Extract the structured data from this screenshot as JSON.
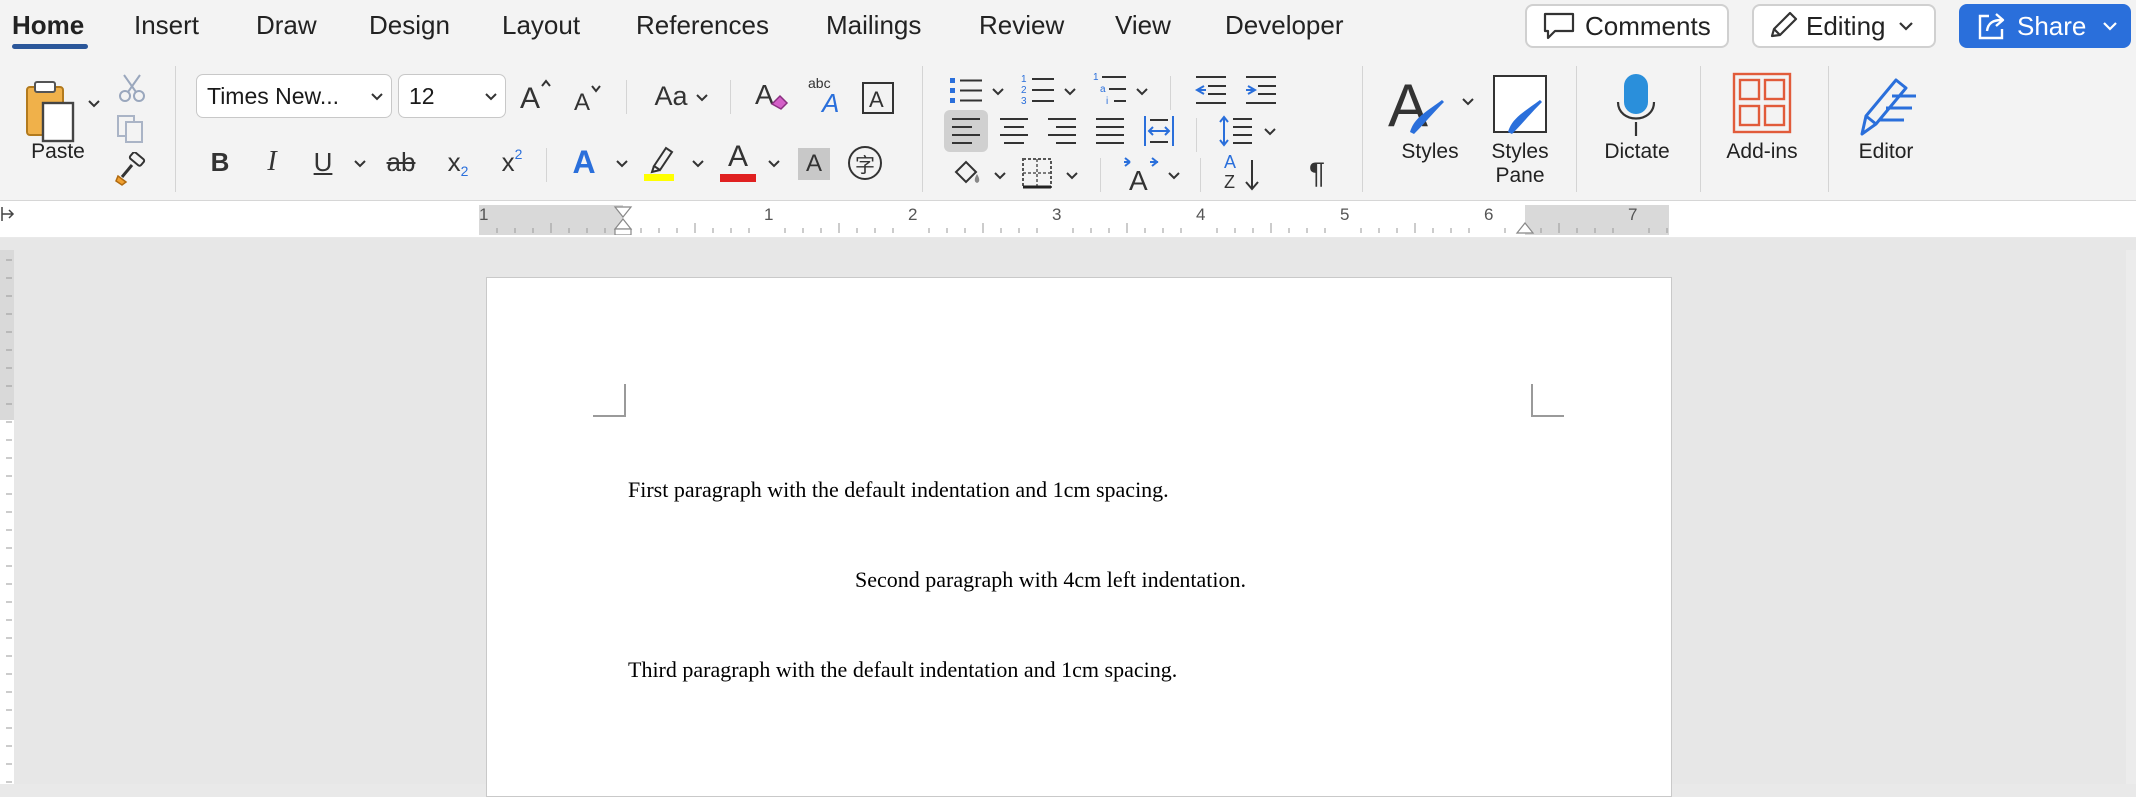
{
  "tabs": [
    {
      "label": "Home",
      "active": true
    },
    {
      "label": "Insert"
    },
    {
      "label": "Draw"
    },
    {
      "label": "Design"
    },
    {
      "label": "Layout"
    },
    {
      "label": "References"
    },
    {
      "label": "Mailings"
    },
    {
      "label": "Review"
    },
    {
      "label": "View"
    },
    {
      "label": "Developer"
    }
  ],
  "header": {
    "comments_label": "Comments",
    "editing_label": "Editing",
    "share_label": "Share"
  },
  "ribbon": {
    "paste_label": "Paste",
    "font_name": "Times New...",
    "font_size": "12",
    "change_case_label": "Aa",
    "styles_label": "Styles",
    "styles_pane_label_1": "Styles",
    "styles_pane_label_2": "Pane",
    "dictate_label": "Dictate",
    "addins_label": "Add-ins",
    "editor_label": "Editor",
    "bold": "B",
    "italic": "I",
    "underline": "U",
    "strike": "ab",
    "subscript": "x",
    "subscript_mark": "2",
    "superscript": "x",
    "superscript_mark": "2",
    "pilcrow": "¶",
    "phonetic_glyph": "字",
    "font_color_letter": "A",
    "shading_letter": "A",
    "text_effects_letter": "A",
    "sort_a": "A",
    "sort_z": "Z"
  },
  "ruler": {
    "numbers": [
      "1",
      "1",
      "2",
      "3",
      "4",
      "5",
      "6",
      "7"
    ]
  },
  "document": {
    "paragraphs": [
      "First paragraph with the default indentation and 1cm spacing.",
      "Second paragraph with 4cm left indentation.",
      "Third paragraph with the default indentation and 1cm spacing."
    ]
  },
  "colors": {
    "accent": "#2b579a",
    "share": "#2a6fdb",
    "highlight": "#ffff00",
    "font_color": "#e02020",
    "addins": "#e15b3a"
  }
}
